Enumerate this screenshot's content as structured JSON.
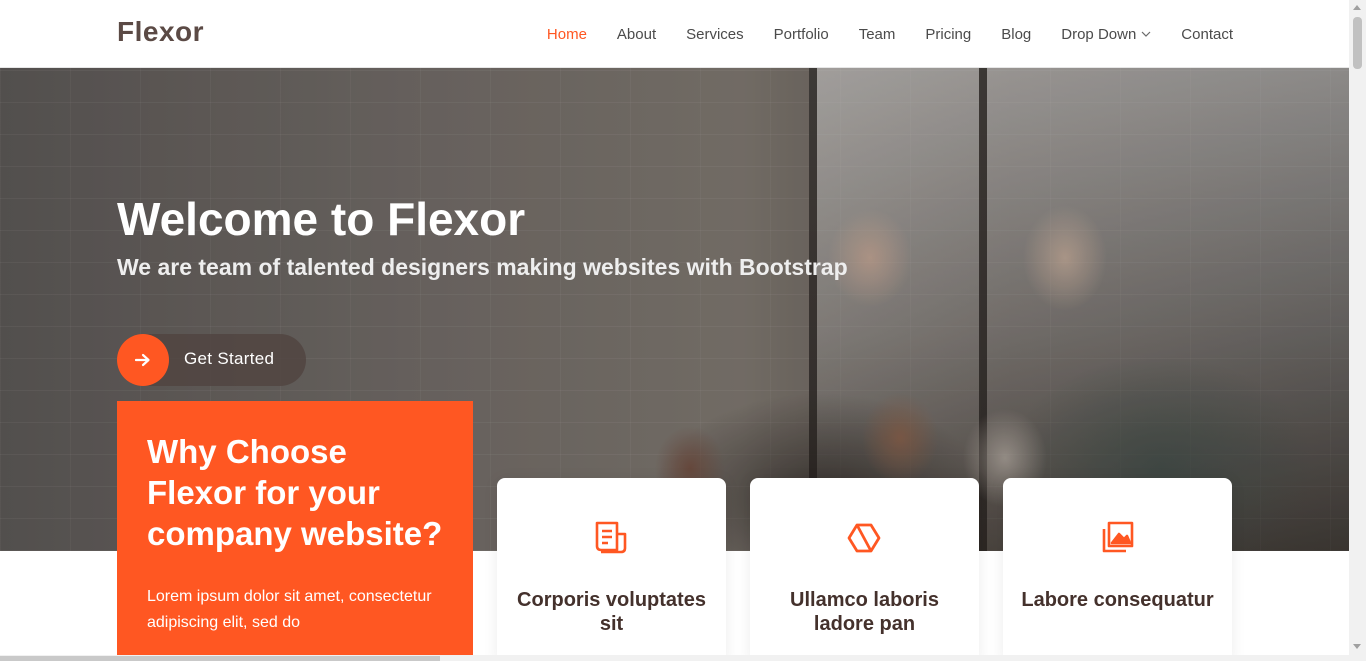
{
  "header": {
    "logo": "Flexor",
    "nav": [
      {
        "label": "Home",
        "active": true
      },
      {
        "label": "About"
      },
      {
        "label": "Services"
      },
      {
        "label": "Portfolio"
      },
      {
        "label": "Team"
      },
      {
        "label": "Pricing"
      },
      {
        "label": "Blog"
      },
      {
        "label": "Drop Down",
        "has_dropdown": true
      },
      {
        "label": "Contact"
      }
    ]
  },
  "hero": {
    "title": "Welcome to Flexor",
    "subtitle": "We are team of talented designers making websites with Bootstrap",
    "cta_label": "Get Started",
    "cta_icon": "arrow-right-icon"
  },
  "why": {
    "title": "Why Choose Flexor for your company website?",
    "text": "Lorem ipsum dolor sit amet, consectetur adipiscing elit, sed do"
  },
  "icon_boxes": [
    {
      "icon": "receipt-icon",
      "title": "Corporis voluptates sit"
    },
    {
      "icon": "cube-alt-icon",
      "title": "Ullamco laboris ladore pan"
    },
    {
      "icon": "images-icon",
      "title": "Labore consequatur"
    }
  ],
  "colors": {
    "accent": "#ff5722",
    "text_dark": "#44312c",
    "nav_text": "#4b4b4b",
    "logo": "#5b4a45"
  }
}
